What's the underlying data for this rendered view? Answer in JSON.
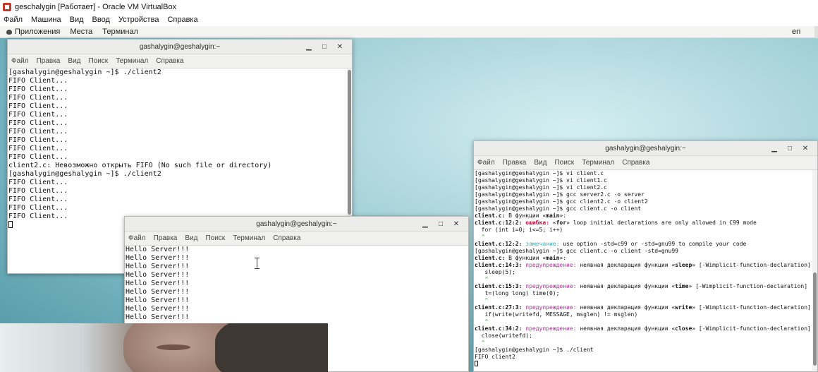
{
  "vbox": {
    "title": "geschalygin [Работает] - Oracle VM VirtualBox",
    "menu": [
      "Файл",
      "Машина",
      "Вид",
      "Ввод",
      "Устройства",
      "Справка"
    ]
  },
  "topbar": {
    "apps": "Приложения",
    "places": "Места",
    "terminal": "Терминал",
    "lang": "en"
  },
  "term_menu": [
    "Файл",
    "Правка",
    "Вид",
    "Поиск",
    "Терминал",
    "Справка"
  ],
  "terminals": [
    {
      "title": "gashalygin@geshalygin:~",
      "lines": [
        "[gashalygin@geshalygin ~]$ ./client2",
        "FIFO Client...",
        "FIFO Client...",
        "FIFO Client...",
        "FIFO Client...",
        "FIFO Client...",
        "FIFO Client...",
        "FIFO Client...",
        "FIFO Client...",
        "FIFO Client...",
        "FIFO Client...",
        "client2.c: Невозможно открыть FIFO (No such file or directory)",
        "[gashalygin@geshalygin ~]$ ./client2",
        "FIFO Client...",
        "FIFO Client...",
        "FIFO Client...",
        "FIFO Client...",
        "FIFO Client..."
      ]
    },
    {
      "title": "gashalygin@geshalygin:~",
      "lines": [
        "Hello Server!!!",
        "Hello Server!!!",
        "Hello Server!!!",
        "Hello Server!!!",
        "Hello Server!!!",
        "Hello Server!!!",
        "Hello Server!!!",
        "Hello Server!!!",
        "Hello Server!!!"
      ]
    },
    {
      "title": "gashalygin@geshalygin:~",
      "lines": [
        [
          {
            "t": "[gashalygin@geshalygin ~]$ vi client.c"
          }
        ],
        [
          {
            "t": "[gashalygin@geshalygin ~]$ vi client1.c"
          }
        ],
        [
          {
            "t": "[gashalygin@geshalygin ~]$ vi client2.c"
          }
        ],
        [
          {
            "t": "[gashalygin@geshalygin ~]$ gcc server2.c -o server"
          }
        ],
        [
          {
            "t": "[gashalygin@geshalygin ~]$ gcc client2.c -o client2"
          }
        ],
        [
          {
            "t": "[gashalygin@geshalygin ~]$ gcc client.c -o client"
          }
        ],
        [
          {
            "t": "client.c:",
            "c": "file"
          },
          {
            "t": " В функции «"
          },
          {
            "t": "main",
            "c": "bold"
          },
          {
            "t": "»:"
          }
        ],
        [
          {
            "t": "client.c:12:2: ",
            "c": "file"
          },
          {
            "t": "ошибка: ",
            "c": "err"
          },
          {
            "t": "«"
          },
          {
            "t": "for",
            "c": "bold"
          },
          {
            "t": "» loop initial declarations are only allowed in C99 mode"
          }
        ],
        [
          {
            "t": "  for (int i=0; i<=5; i++)"
          }
        ],
        [
          {
            "t": "  ^",
            "c": "caret"
          }
        ],
        [
          {
            "t": "client.c:12:2: ",
            "c": "file"
          },
          {
            "t": "замечание: ",
            "c": "note"
          },
          {
            "t": "use option -std=c99 or -std=gnu99 to compile your code"
          }
        ],
        [
          {
            "t": "[gashalygin@geshalygin ~]$ gcc client.c -o client -std=gnu99"
          }
        ],
        [
          {
            "t": "client.c:",
            "c": "file"
          },
          {
            "t": " В функции «"
          },
          {
            "t": "main",
            "c": "bold"
          },
          {
            "t": "»:"
          }
        ],
        [
          {
            "t": "client.c:14:3: ",
            "c": "file"
          },
          {
            "t": "предупреждение: ",
            "c": "warn"
          },
          {
            "t": "неявная декларация функции «"
          },
          {
            "t": "sleep",
            "c": "bold"
          },
          {
            "t": "» [-Wimplicit-function-declaration]"
          }
        ],
        [
          {
            "t": "   sleep(5);"
          }
        ],
        [
          {
            "t": "   ^",
            "c": "caret"
          }
        ],
        [
          {
            "t": "client.c:15:3: ",
            "c": "file"
          },
          {
            "t": "предупреждение: ",
            "c": "warn"
          },
          {
            "t": "неявная декларация функции «"
          },
          {
            "t": "time",
            "c": "bold"
          },
          {
            "t": "» [-Wimplicit-function-declaration]"
          }
        ],
        [
          {
            "t": "   t=(long long) time(0);"
          }
        ],
        [
          {
            "t": "   ^",
            "c": "caret"
          }
        ],
        [
          {
            "t": "client.c:27:3: ",
            "c": "file"
          },
          {
            "t": "предупреждение: ",
            "c": "warn"
          },
          {
            "t": "неявная декларация функции «"
          },
          {
            "t": "write",
            "c": "bold"
          },
          {
            "t": "» [-Wimplicit-function-declaration]"
          }
        ],
        [
          {
            "t": "   if(write(writefd, MESSAGE, msglen) != msglen)"
          }
        ],
        [
          {
            "t": "   ^",
            "c": "caret"
          }
        ],
        [
          {
            "t": "client.c:34:2: ",
            "c": "file"
          },
          {
            "t": "предупреждение: ",
            "c": "warn"
          },
          {
            "t": "неявная декларация функции «"
          },
          {
            "t": "close",
            "c": "bold"
          },
          {
            "t": "» [-Wimplicit-function-declaration]"
          }
        ],
        [
          {
            "t": "  close(writefd);"
          }
        ],
        [
          {
            "t": "  ^",
            "c": "caret"
          }
        ],
        [
          {
            "t": "[gashalygin@geshalygin ~]$ ./client"
          }
        ],
        [
          {
            "t": "FIFO client2"
          }
        ]
      ]
    }
  ],
  "window_controls": {
    "minimize": "▁",
    "maximize": "□",
    "close": "✕"
  }
}
